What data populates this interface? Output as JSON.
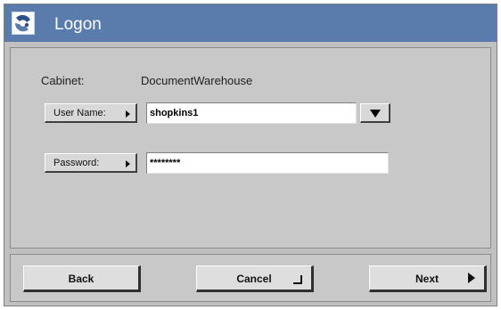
{
  "window": {
    "title": "Logon",
    "icon": "app-logo-icon"
  },
  "cabinet": {
    "label": "Cabinet:",
    "value": "DocumentWarehouse"
  },
  "username": {
    "button_label": "User Name:",
    "value": "shopkins1"
  },
  "password": {
    "button_label": "Password:",
    "value": "********"
  },
  "footer": {
    "back_label": "Back",
    "cancel_label": "Cancel",
    "next_label": "Next"
  },
  "colors": {
    "titlebar": "#5a7cac",
    "panel": "#c8c8c8"
  }
}
